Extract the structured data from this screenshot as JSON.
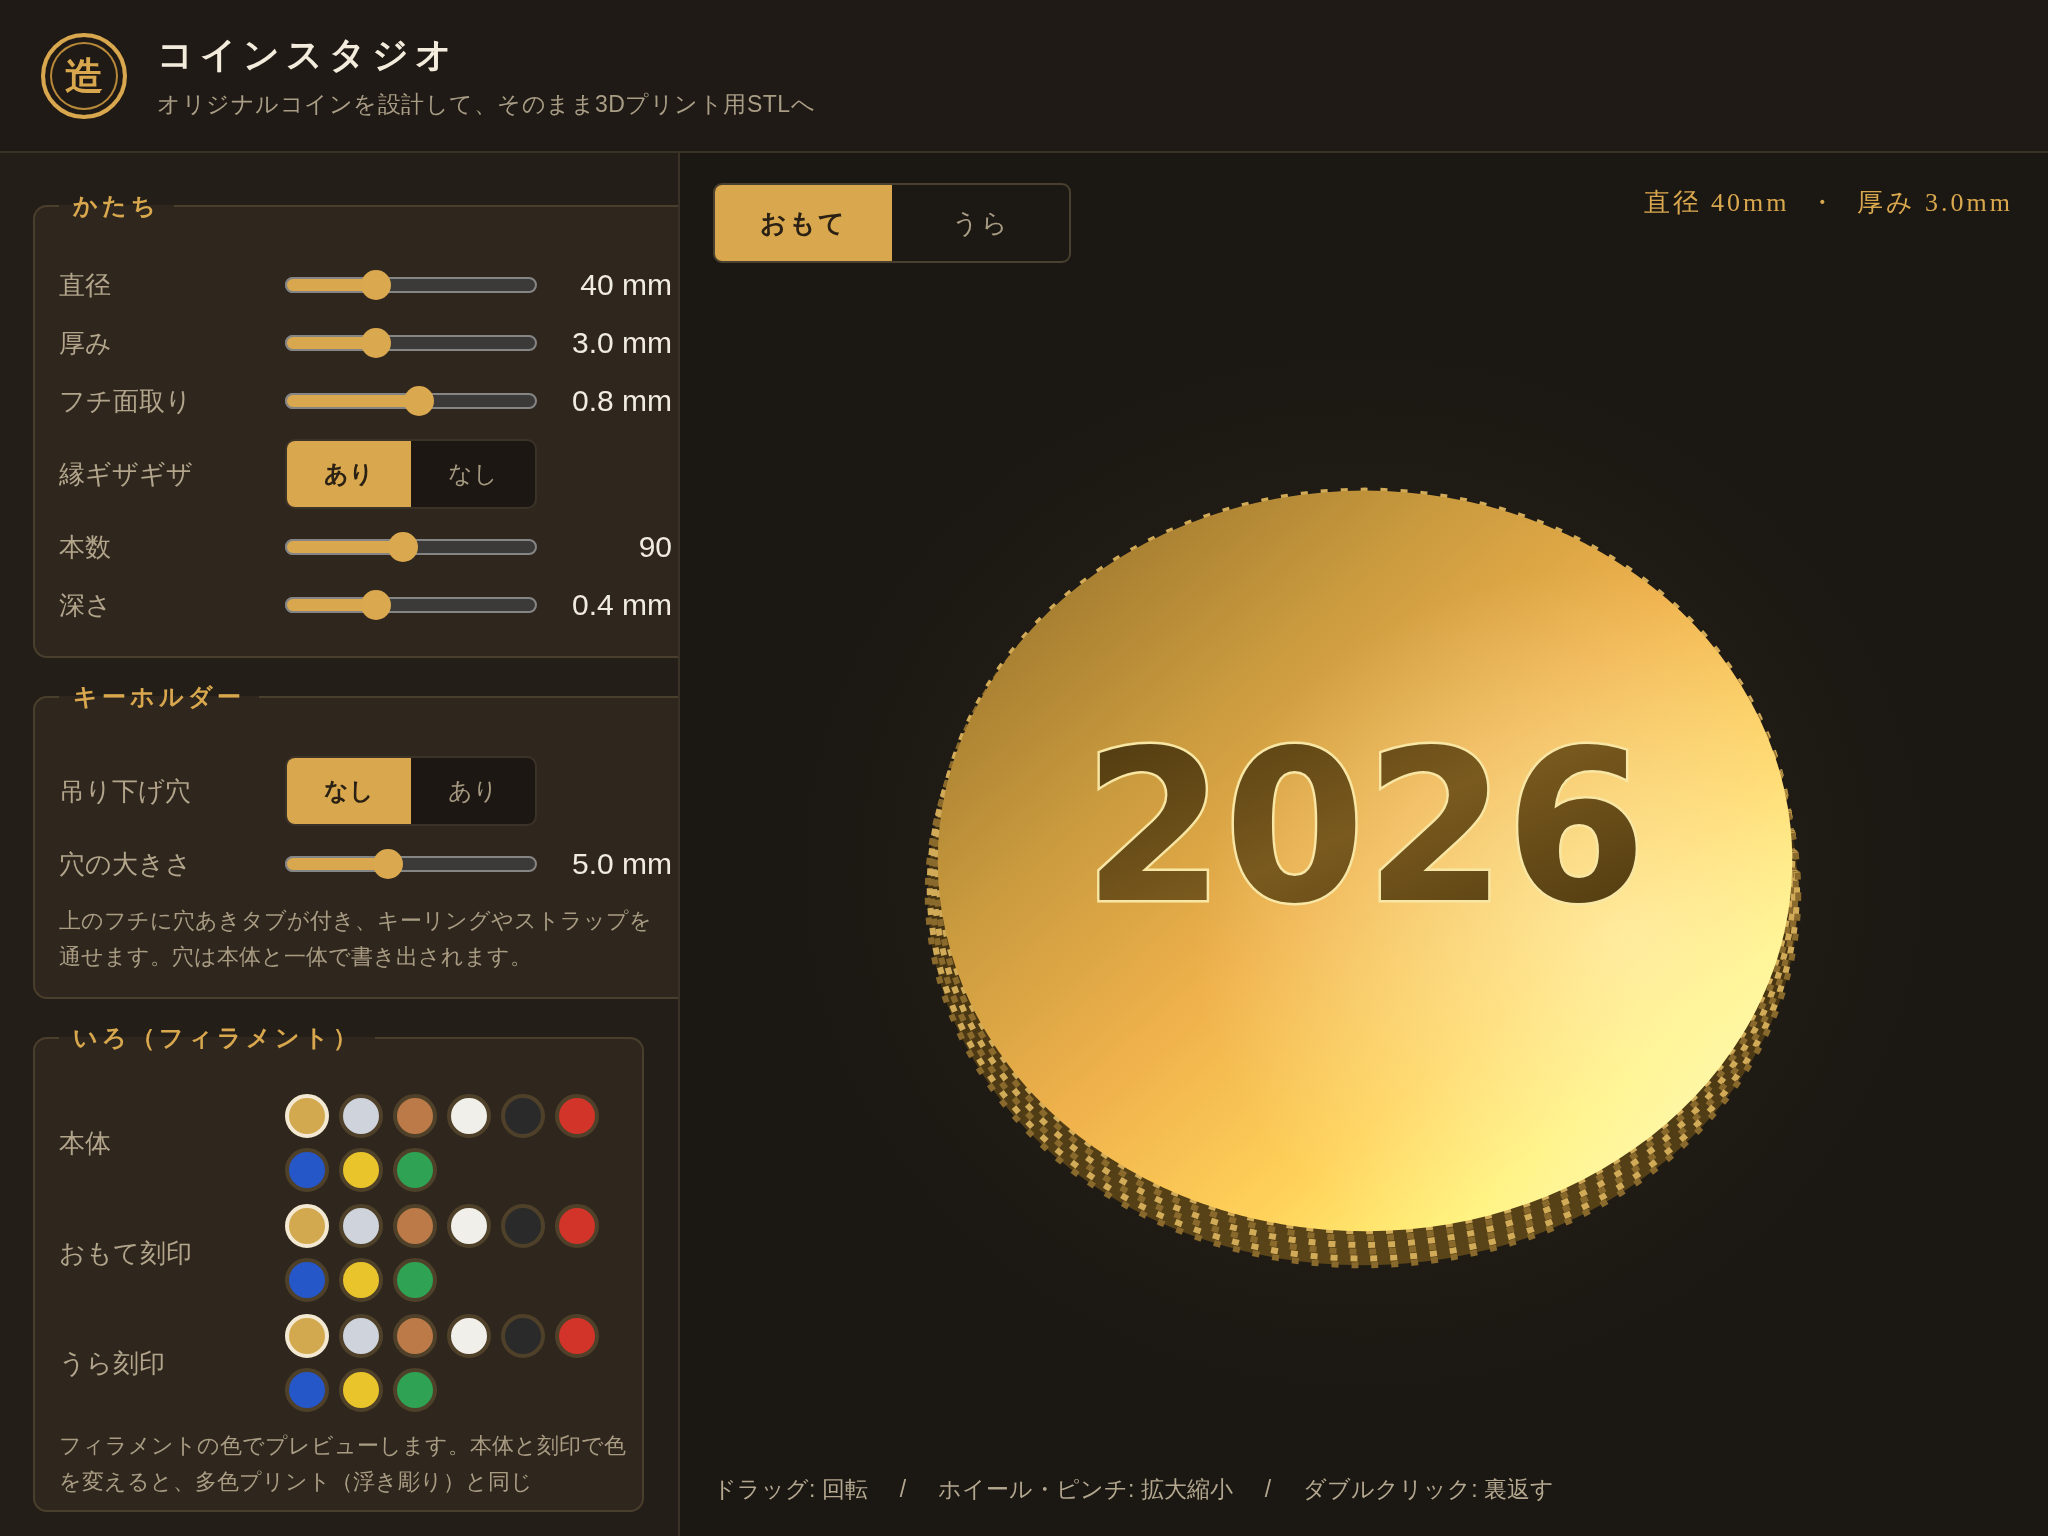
{
  "header": {
    "logo_text": "造",
    "title": "コインスタジオ",
    "subtitle": "オリジナルコインを設計して、そのまま3Dプリント用STLへ"
  },
  "sidebar": {
    "sections": [
      {
        "title": "かたち",
        "rows": [
          {
            "kind": "slider",
            "label": "直径",
            "level": 0.36,
            "reading": "40 mm"
          },
          {
            "kind": "slider",
            "label": "厚み",
            "level": 0.36,
            "reading": "3.0 mm"
          },
          {
            "kind": "slider",
            "label": "フチ面取り",
            "level": 0.53,
            "reading": "0.8 mm"
          },
          {
            "kind": "toggle",
            "label": "縁ギザギザ",
            "options": [
              {
                "label": "あり",
                "selected": true
              },
              {
                "label": "なし",
                "selected": false
              }
            ]
          },
          {
            "kind": "slider",
            "label": "本数",
            "level": 0.47,
            "reading": "90"
          },
          {
            "kind": "slider",
            "label": "深さ",
            "level": 0.36,
            "reading": "0.4 mm"
          }
        ]
      },
      {
        "title": "キーホルダー",
        "rows": [
          {
            "kind": "toggle",
            "label": "吊り下げ穴",
            "options": [
              {
                "label": "なし",
                "selected": true
              },
              {
                "label": "あり",
                "selected": false
              }
            ]
          },
          {
            "kind": "slider",
            "label": "穴の大きさ",
            "level": 0.41,
            "reading": "5.0 mm"
          },
          {
            "kind": "note",
            "text": "上のフチに穴あきタブが付き、キーリングやストラップを通せます。穴は本体と一体で書き出されます。"
          }
        ]
      },
      {
        "title": "いろ（フィラメント）",
        "rows": [
          {
            "kind": "swatches",
            "label": "本体",
            "swatches": [
              {
                "color": "#d2a94f",
                "selected": true
              },
              {
                "color": "#cfd3dc",
                "selected": false
              },
              {
                "color": "#bb7a48",
                "selected": false
              },
              {
                "color": "#f0efe9",
                "selected": false
              },
              {
                "color": "#2a2a2a",
                "selected": false
              },
              {
                "color": "#d2342a",
                "selected": false
              },
              {
                "color": "#2657c8",
                "selected": false
              },
              {
                "color": "#e9c52b",
                "selected": false
              },
              {
                "color": "#2fa253",
                "selected": false
              }
            ]
          },
          {
            "kind": "swatches",
            "label": "おもて刻印",
            "swatches": [
              {
                "color": "#d2a94f",
                "selected": true
              },
              {
                "color": "#cfd3dc",
                "selected": false
              },
              {
                "color": "#bb7a48",
                "selected": false
              },
              {
                "color": "#f0efe9",
                "selected": false
              },
              {
                "color": "#2a2a2a",
                "selected": false
              },
              {
                "color": "#d2342a",
                "selected": false
              },
              {
                "color": "#2657c8",
                "selected": false
              },
              {
                "color": "#e9c52b",
                "selected": false
              },
              {
                "color": "#2fa253",
                "selected": false
              }
            ]
          },
          {
            "kind": "swatches",
            "label": "うら刻印",
            "swatches": [
              {
                "color": "#d2a94f",
                "selected": true
              },
              {
                "color": "#cfd3dc",
                "selected": false
              },
              {
                "color": "#bb7a48",
                "selected": false
              },
              {
                "color": "#f0efe9",
                "selected": false
              },
              {
                "color": "#2a2a2a",
                "selected": false
              },
              {
                "color": "#d2342a",
                "selected": false
              },
              {
                "color": "#2657c8",
                "selected": false
              },
              {
                "color": "#e9c52b",
                "selected": false
              },
              {
                "color": "#2fa253",
                "selected": false
              }
            ]
          },
          {
            "kind": "note",
            "text": "フィラメントの色でプレビューします。本体と刻印で色を変えると、多色プリント（浮き彫り）と同じ"
          }
        ]
      }
    ]
  },
  "preview": {
    "tabs": [
      {
        "label": "おもて",
        "selected": true
      },
      {
        "label": "うら",
        "selected": false
      }
    ],
    "dimensions": "直径 40mm  ・  厚み 3.0mm",
    "engraving": "2026",
    "hint": "ドラッグ: 回転     /     ホイール・ピンチ: 拡大縮小     /     ダブルクリック: 裏返す"
  }
}
